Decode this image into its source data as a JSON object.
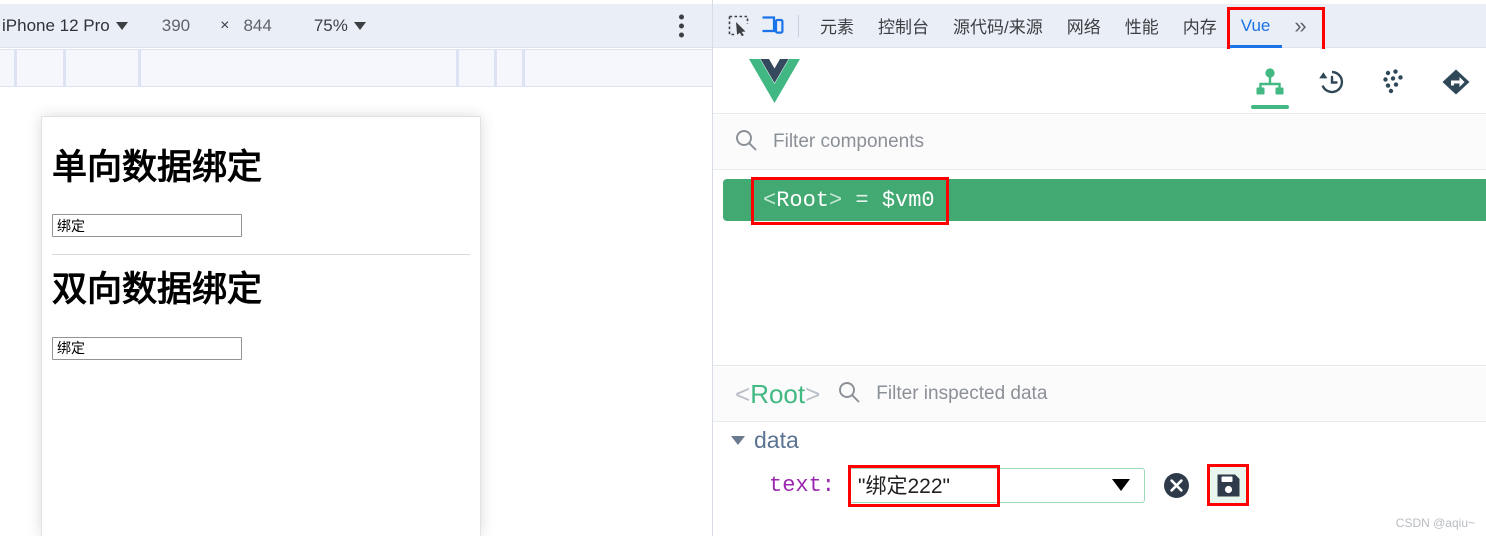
{
  "device_toolbar": {
    "device_name": "iPhone 12 Pro",
    "width": "390",
    "times": "×",
    "height": "844",
    "zoom": "75%",
    "more_label": "more-options"
  },
  "page_preview": {
    "sections": [
      {
        "heading": "单向数据绑定",
        "input_value": "绑定"
      },
      {
        "heading": "双向数据绑定",
        "input_value": "绑定"
      }
    ]
  },
  "devtools": {
    "icons": {
      "inspect": "inspect-element-icon",
      "device": "device-toolbar-icon"
    },
    "tabs": [
      {
        "label": "元素",
        "active": false
      },
      {
        "label": "控制台",
        "active": false
      },
      {
        "label": "源代码/来源",
        "active": false
      },
      {
        "label": "网络",
        "active": false
      },
      {
        "label": "性能",
        "active": false
      },
      {
        "label": "内存",
        "active": false
      },
      {
        "label": "Vue",
        "active": true
      }
    ],
    "overflow": "»"
  },
  "vue_panel": {
    "logo": "vue-logo",
    "tools": [
      {
        "name": "components-tree-icon",
        "active": true
      },
      {
        "name": "timeline-history-icon",
        "active": false
      },
      {
        "name": "vuex-dots-icon",
        "active": false
      },
      {
        "name": "router-icon",
        "active": false
      }
    ],
    "filter": {
      "placeholder": "Filter components",
      "value": ""
    },
    "tree": {
      "root_open": "<",
      "root_name": "Root",
      "root_close": ">",
      "equals": "=",
      "instance": "$vm0"
    },
    "inspector": {
      "selected_open": "<",
      "selected_name": "Root",
      "selected_close": ">",
      "filter_placeholder": "Filter inspected data",
      "filter_value": ""
    },
    "data": {
      "group_label": "data",
      "field_name": "text:",
      "field_value": "\"绑定222\"",
      "cancel_icon": "cancel-circle-icon",
      "save_icon": "save-floppy-icon"
    }
  },
  "watermark": "CSDN @aqiu~",
  "colors": {
    "vue_green": "#42b883",
    "selected_green": "#42a972",
    "annotation_red": "#ff0000",
    "chrome_blue": "#1a73e8",
    "toolbar_bg": "#eaeef6"
  }
}
